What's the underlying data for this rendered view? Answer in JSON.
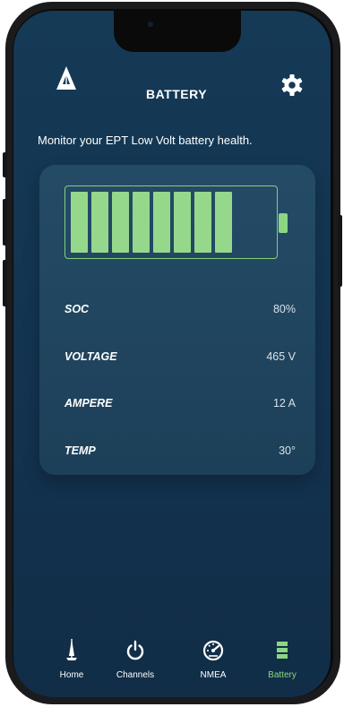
{
  "header": {
    "title": "BATTERY",
    "logo_icon": "sailboat-logo-icon",
    "settings_icon": "gear-icon"
  },
  "subtitle": "Monitor  your  EPT Low Volt battery health.",
  "battery": {
    "charge_percent": 80,
    "filled_cells": 8,
    "fill_color": "#95d88c"
  },
  "stats": [
    {
      "label": "SOC",
      "value": "80%"
    },
    {
      "label": "VOLTAGE",
      "value": "465 V"
    },
    {
      "label": "AMPERE",
      "value": "12 A"
    },
    {
      "label": "TEMP",
      "value": "30°"
    }
  ],
  "tabs": [
    {
      "label": "Home",
      "icon": "sailboat-icon",
      "active": false
    },
    {
      "label": "Channels",
      "icon": "power-icon",
      "active": false
    },
    {
      "label": "NMEA",
      "icon": "gauge-icon",
      "active": false
    },
    {
      "label": "Battery",
      "icon": "battery-icon",
      "active": true
    }
  ],
  "colors": {
    "accent": "#8bd683",
    "background": "#153a56"
  }
}
